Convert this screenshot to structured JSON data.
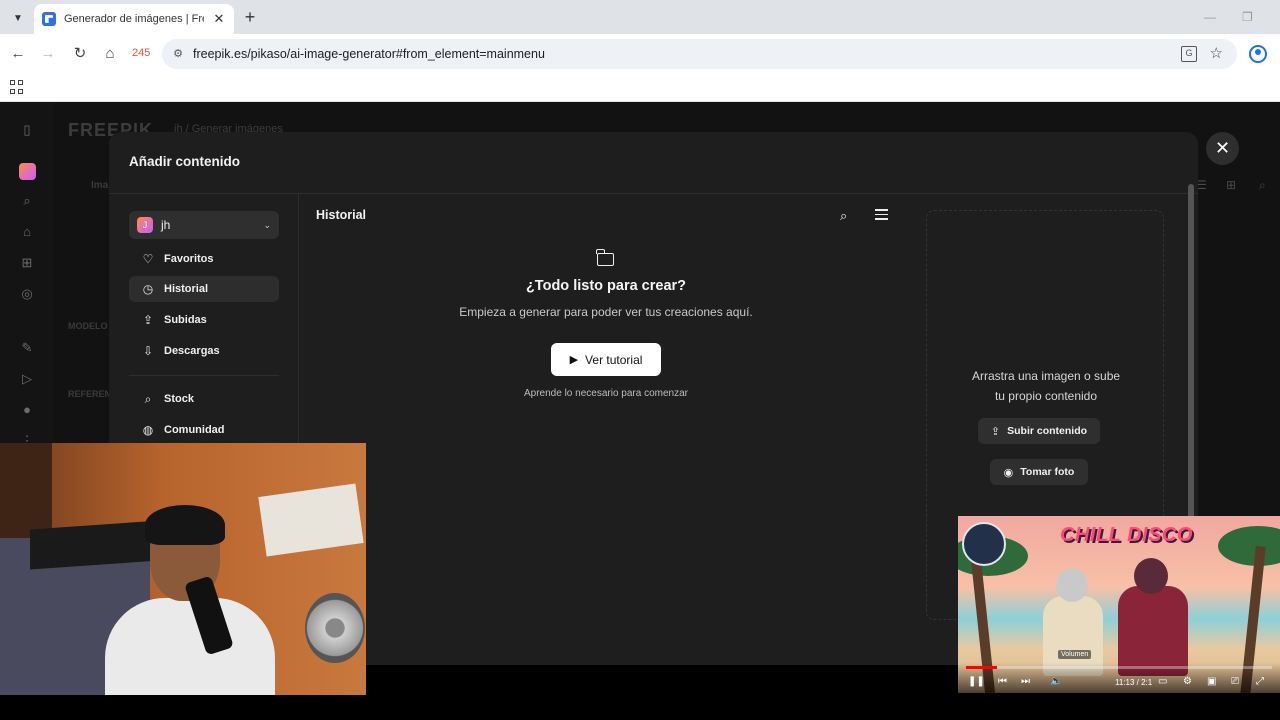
{
  "browser": {
    "tab_title": "Generador de imágenes | Freepik",
    "url": "freepik.es/pikaso/ai-image-generator#from_element=mainmenu",
    "extension_count": "245"
  },
  "background_page": {
    "logo": "FREEPIK",
    "breadcrumb": "jh   /   Generar imágenes",
    "label_image": "Ima",
    "label_model": "MODELO",
    "label_reference": "REFERENC"
  },
  "modal": {
    "title": "Añadir contenido",
    "workspace": {
      "avatar_letter": "J",
      "name": "jh"
    },
    "nav": [
      {
        "label": "Favoritos",
        "icon": "heart-icon"
      },
      {
        "label": "Historial",
        "icon": "clock-icon",
        "active": true
      },
      {
        "label": "Subidas",
        "icon": "upload-icon"
      },
      {
        "label": "Descargas",
        "icon": "download-icon"
      },
      {
        "label": "Stock",
        "icon": "search-icon"
      },
      {
        "label": "Comunidad",
        "icon": "globe-icon"
      }
    ],
    "content_title": "Historial",
    "empty": {
      "title": "¿Todo listo para crear?",
      "subtitle": "Empieza a generar para poder ver tus creaciones aquí.",
      "tutorial_button": "Ver tutorial",
      "hint": "Aprende lo necesario para comenzar"
    },
    "dropzone": {
      "text_line1": "Arrastra una imagen o sube",
      "text_line2": "tu propio contenido",
      "upload_button": "Subir contenido",
      "photo_button": "Tomar foto"
    }
  },
  "music_pip": {
    "title": "CHILL DISCO",
    "volume_tooltip": "Volumen",
    "time": "11:13 / 2:1",
    "progress_fraction": 0.1
  }
}
